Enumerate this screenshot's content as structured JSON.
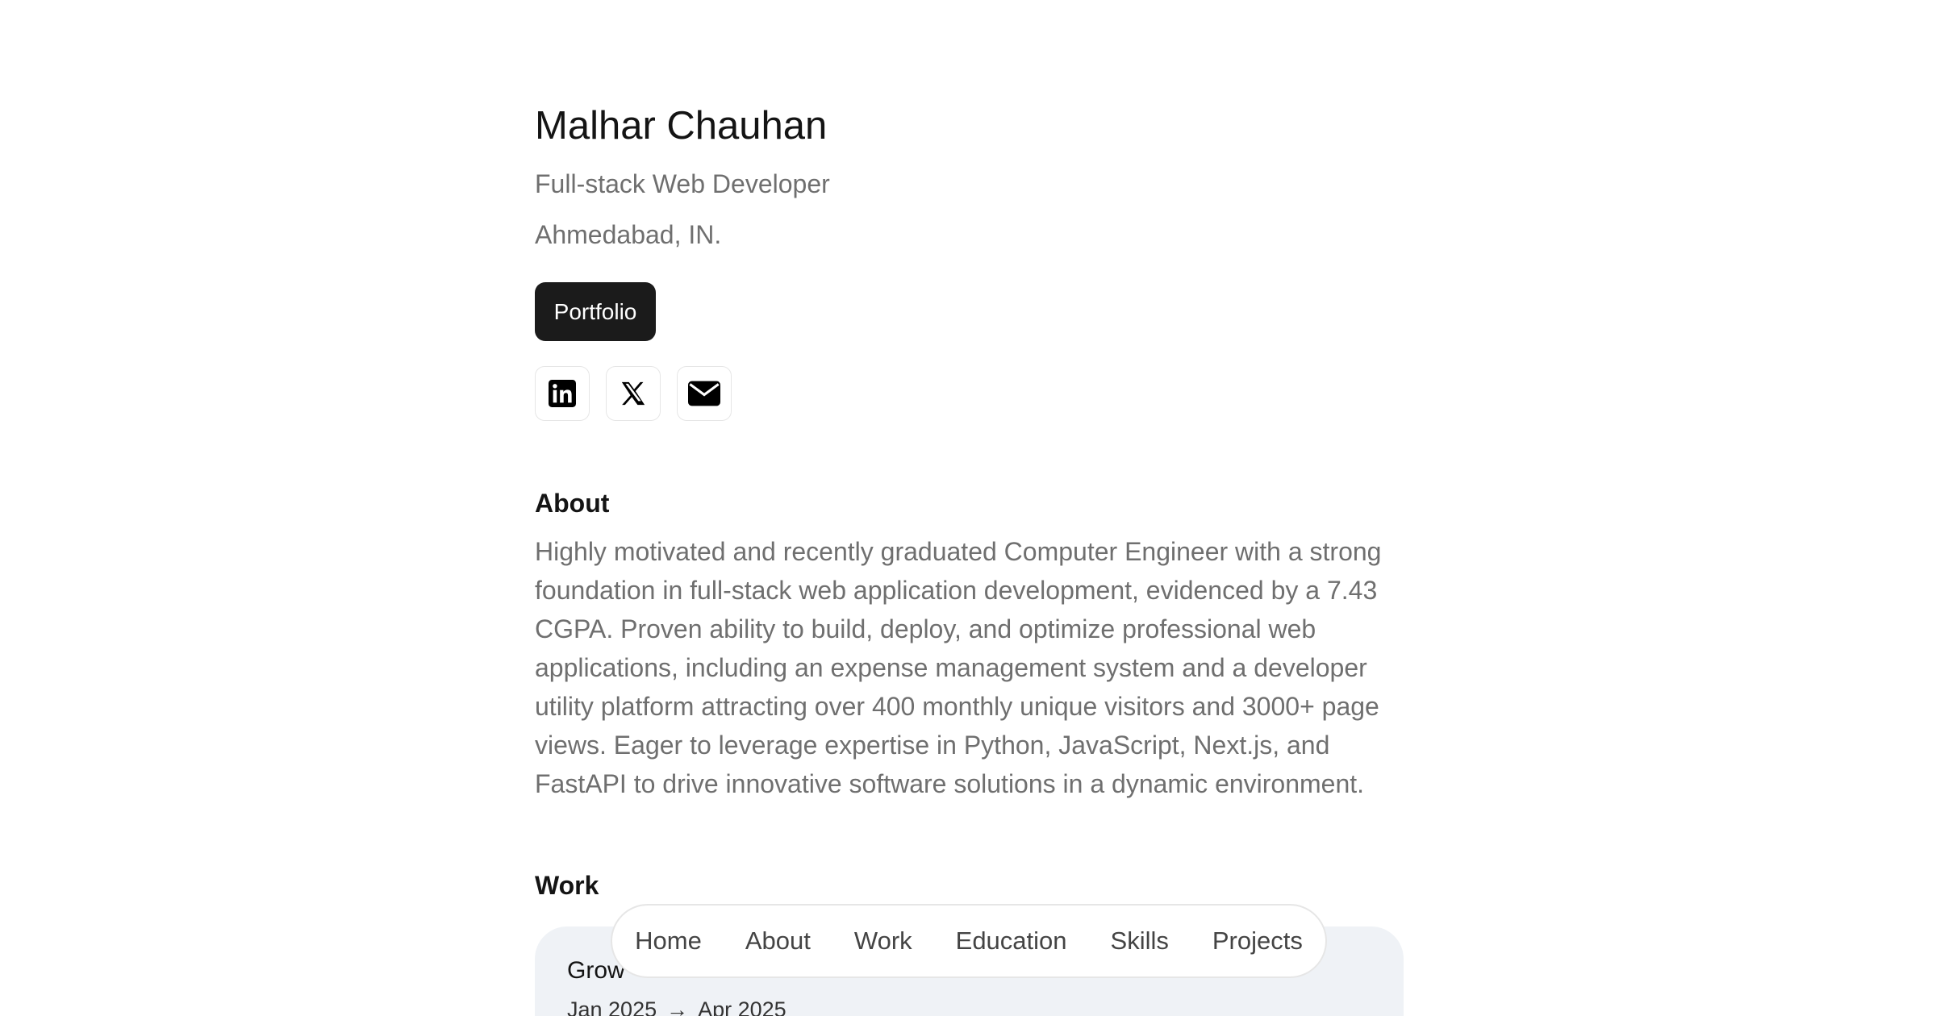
{
  "profile": {
    "name": "Malhar Chauhan",
    "role": "Full-stack Web Developer",
    "location": "Ahmedabad, IN.",
    "portfolio_label": "Portfolio"
  },
  "socials": [
    {
      "icon": "linkedin-icon"
    },
    {
      "icon": "x-icon"
    },
    {
      "icon": "mail-icon"
    }
  ],
  "about": {
    "title": "About",
    "text": "Highly motivated and recently graduated Computer Engineer with a strong foundation in full-stack web application development, evidenced by a 7.43 CGPA. Proven ability to build, deploy, and optimize professional web applications, including an expense management system and a developer utility platform attracting over 400 monthly unique visitors and 3000+ page views. Eager to leverage expertise in Python, JavaScript, Next.js, and FastAPI to drive innovative software solutions in a dynamic environment."
  },
  "work": {
    "title": "Work",
    "items": [
      {
        "company": "Grow",
        "start": "Jan 2025",
        "arrow": "→",
        "end": "Apr 2025"
      }
    ]
  },
  "nav": {
    "items": [
      "Home",
      "About",
      "Work",
      "Education",
      "Skills",
      "Projects"
    ]
  },
  "colors": {
    "text_primary": "#141414",
    "text_muted": "#6f6f6f",
    "button_bg": "#1b1b1b",
    "card_bg": "#eff2f6"
  }
}
